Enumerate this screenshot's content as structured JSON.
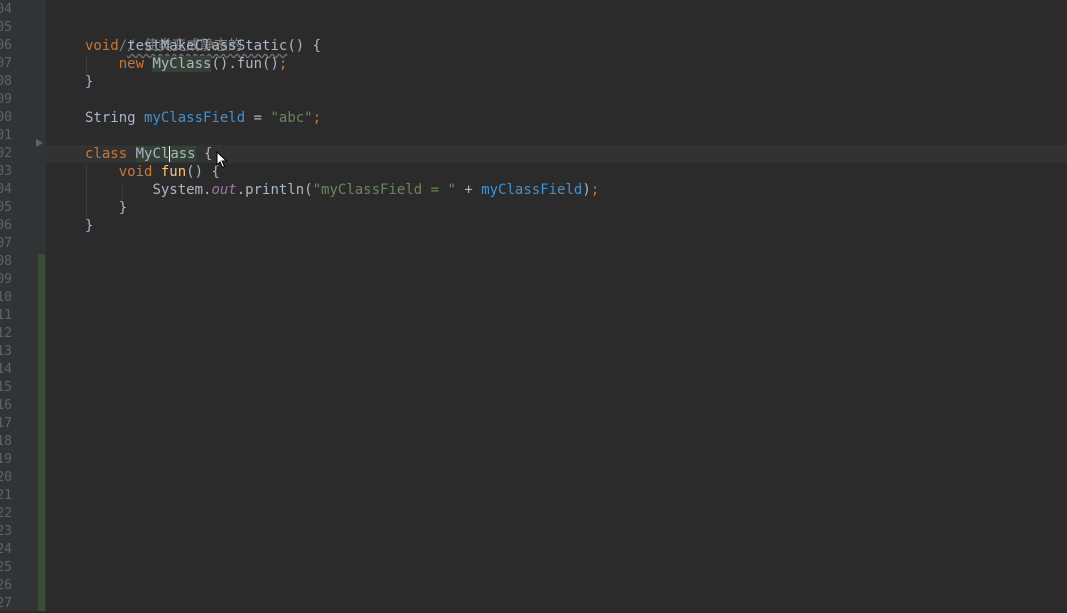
{
  "line_numbers": [
    "04",
    "05",
    "06",
    "07",
    "08",
    "09",
    "00",
    "01",
    "02",
    "03",
    "04",
    "05",
    "06",
    "07",
    "08",
    "09",
    "10",
    "11",
    "12",
    "13",
    "14",
    "15",
    "16",
    "17",
    "18",
    "19",
    "20",
    "21",
    "22",
    "23",
    "24",
    "25",
    "26",
    "27"
  ],
  "code": {
    "comment": "// 使类变成静态的",
    "l2_kw": "void",
    "l2_method": "testMakeClassStatic",
    "l2_rest": "() {",
    "l3_kw": "new",
    "l3_cls": "MyClass",
    "l3_rest": "().fun()",
    "l3_semi": ";",
    "l4": "}",
    "l6_type": "String",
    "l6_field": "myClassField",
    "l6_eq": " = ",
    "l6_str": "\"abc\"",
    "l6_semi": ";",
    "l8_kw": "class",
    "l8_cls_a": "MyCl",
    "l8_cls_b": "ass",
    "l8_rest": " {",
    "l9_kw": "void",
    "l9_method": "fun",
    "l9_rest": "() {",
    "l10_sys": "System.",
    "l10_out": "out",
    "l10_println": ".println(",
    "l10_str": "\"myClassField = \"",
    "l10_plus": " + ",
    "l10_field": "myClassField",
    "l10_close": ")",
    "l10_semi": ";",
    "l11": "}",
    "l12": "}"
  },
  "icons": {
    "fold": "fold-arrow-icon",
    "cursor": "mouse-pointer-icon"
  },
  "colors": {
    "background": "#2b2b2b",
    "keyword": "#cc7832",
    "string": "#6a8759",
    "field": "#3f93d2",
    "comment": "#808080",
    "static_field": "#9876aa",
    "vcs_added": "#384c38"
  }
}
